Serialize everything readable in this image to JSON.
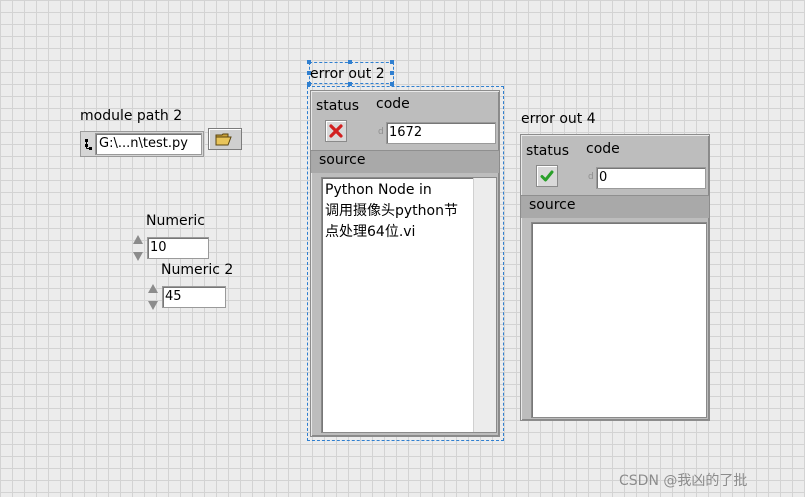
{
  "module_path": {
    "label": "module path 2",
    "value": "G:\\...n\\test.py"
  },
  "numeric": {
    "label": "Numeric",
    "value": "10"
  },
  "numeric2": {
    "label": "Numeric 2",
    "value": "45"
  },
  "error_out_2": {
    "label": "error out 2",
    "status_label": "status",
    "status_icon": "red-x-icon",
    "code_label": "code",
    "code_type_tag": "d",
    "code_value": "1672",
    "source_label": "source",
    "source_text": "Python Node in\n调用摄像头python节\n点处理64位.vi"
  },
  "error_out_4": {
    "label": "error out 4",
    "status_label": "status",
    "status_icon": "green-check-icon",
    "code_label": "code",
    "code_type_tag": "d",
    "code_value": "0",
    "source_label": "source",
    "source_text": ""
  },
  "watermark": "CSDN @我凶的了批",
  "colors": {
    "selection": "#2f7fd0",
    "error_red": "#d22020",
    "ok_green": "#2aa02a"
  }
}
